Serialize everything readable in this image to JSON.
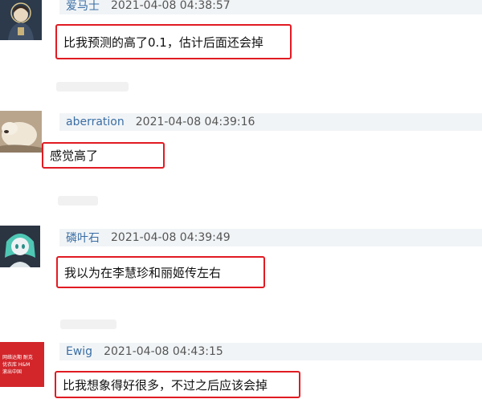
{
  "comments": [
    {
      "username": "爱马士",
      "time": "2021-04-08 04:38:57",
      "text": "比我预测的高了0.1，估计后面还会掉",
      "avatar_icon": "anime-portrait-avatar"
    },
    {
      "username": "aberration",
      "time": "2021-04-08 04:39:16",
      "text": "感觉高了",
      "avatar_icon": "sleeping-dog-avatar"
    },
    {
      "username": "磷叶石",
      "time": "2021-04-08 04:39:49",
      "text": "我以为在李慧珍和丽姬传左右",
      "avatar_icon": "anime-character-avatar"
    },
    {
      "username": "Ewig",
      "time": "2021-04-08 04:43:15",
      "text": "比我想象得好很多，不过之后应该会掉",
      "avatar_icon": "red-news-avatar",
      "avatar_text": [
        "网络达期 耐克",
        "优衣库 H&M",
        "滚出中国"
      ]
    }
  ],
  "colors": {
    "highlight_border": "#e11b22",
    "username": "#3a6ea5",
    "header_bg": "#f1f4f6"
  }
}
